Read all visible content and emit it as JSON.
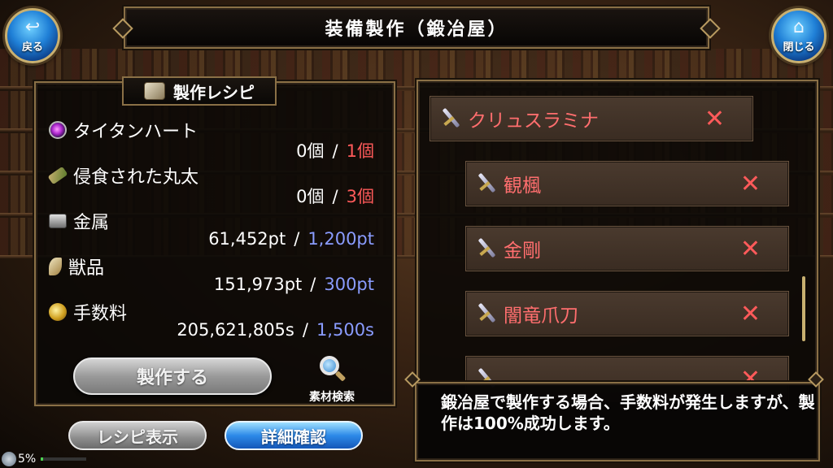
{
  "header": {
    "title": "装備製作（鍛冶屋）",
    "back_label": "戻る",
    "close_label": "閉じる"
  },
  "recipe": {
    "heading": "製作レシピ",
    "ingredients": [
      {
        "name": "タイタンハート",
        "icon": "purple-orb-icon",
        "have": "0個",
        "need": "1個",
        "need_color": "#ff5a5a"
      },
      {
        "name": "侵食された丸太",
        "icon": "log-icon",
        "have": "0個",
        "need": "3個",
        "need_color": "#ff5a5a"
      },
      {
        "name": "金属",
        "icon": "metal-ingot-icon",
        "have": "61,452pt",
        "need": "1,200pt",
        "need_color": "#8a9cff"
      },
      {
        "name": "獣品",
        "icon": "fang-icon",
        "have": "151,973pt",
        "need": "300pt",
        "need_color": "#8a9cff"
      },
      {
        "name": "手数料",
        "icon": "coins-icon",
        "have": "205,621,805s",
        "need": "1,500s",
        "need_color": "#8a9cff"
      }
    ],
    "separator": "/",
    "craft_button": "製作する",
    "search_label": "素材検索"
  },
  "buttons": {
    "recipe_show": "レシピ表示",
    "detail_check": "詳細確認"
  },
  "equipment_list": [
    {
      "name": "クリュスラミナ",
      "remove": "✕"
    },
    {
      "name": "観楓",
      "remove": "✕"
    },
    {
      "name": "金剛",
      "remove": "✕"
    },
    {
      "name": "闇竜爪刀",
      "remove": "✕"
    },
    {
      "name": "",
      "remove": "✕"
    }
  ],
  "message": "鍛冶屋で製作する場合、手数料が発生しますが、製作は100%成功します。",
  "status": {
    "percent": "5%",
    "progress": 0.05
  }
}
